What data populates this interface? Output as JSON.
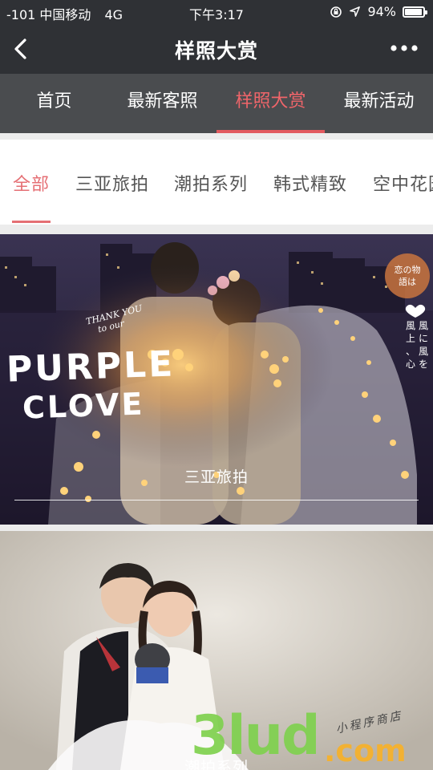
{
  "status_bar": {
    "carrier": "-101 中国移动",
    "network": "4G",
    "time": "下午3:17",
    "battery_percent": "94%",
    "battery_level": 0.94
  },
  "nav": {
    "title": "样照大赏",
    "back_icon": "chevron-left-icon",
    "more_icon": "more-dots-icon"
  },
  "main_tabs": [
    {
      "label": "首页",
      "active": false
    },
    {
      "label": "最新客照",
      "active": false
    },
    {
      "label": "样照大赏",
      "active": true
    },
    {
      "label": "最新活动",
      "active": false
    }
  ],
  "categories": [
    {
      "label": "全部",
      "active": true
    },
    {
      "label": "三亚旅拍",
      "active": false
    },
    {
      "label": "潮拍系列",
      "active": false
    },
    {
      "label": "韩式精致",
      "active": false
    },
    {
      "label": "空中花园",
      "active": false
    }
  ],
  "cards": [
    {
      "caption": "三亚旅拍",
      "photo_text": {
        "headline_1": "PURPLE",
        "headline_2": "CLOVE",
        "script": "THANK YOU",
        "script_2": "to our"
      }
    },
    {
      "caption": "潮拍系列",
      "watermark": {
        "logo": "3lud",
        "domain": ".com",
        "handwriting": "小程序商店"
      }
    }
  ],
  "colors": {
    "header_bg": "#2f3135",
    "tabs_bg": "#4a4c4f",
    "accent": "#e25a5f",
    "page_bg": "#ececec"
  }
}
